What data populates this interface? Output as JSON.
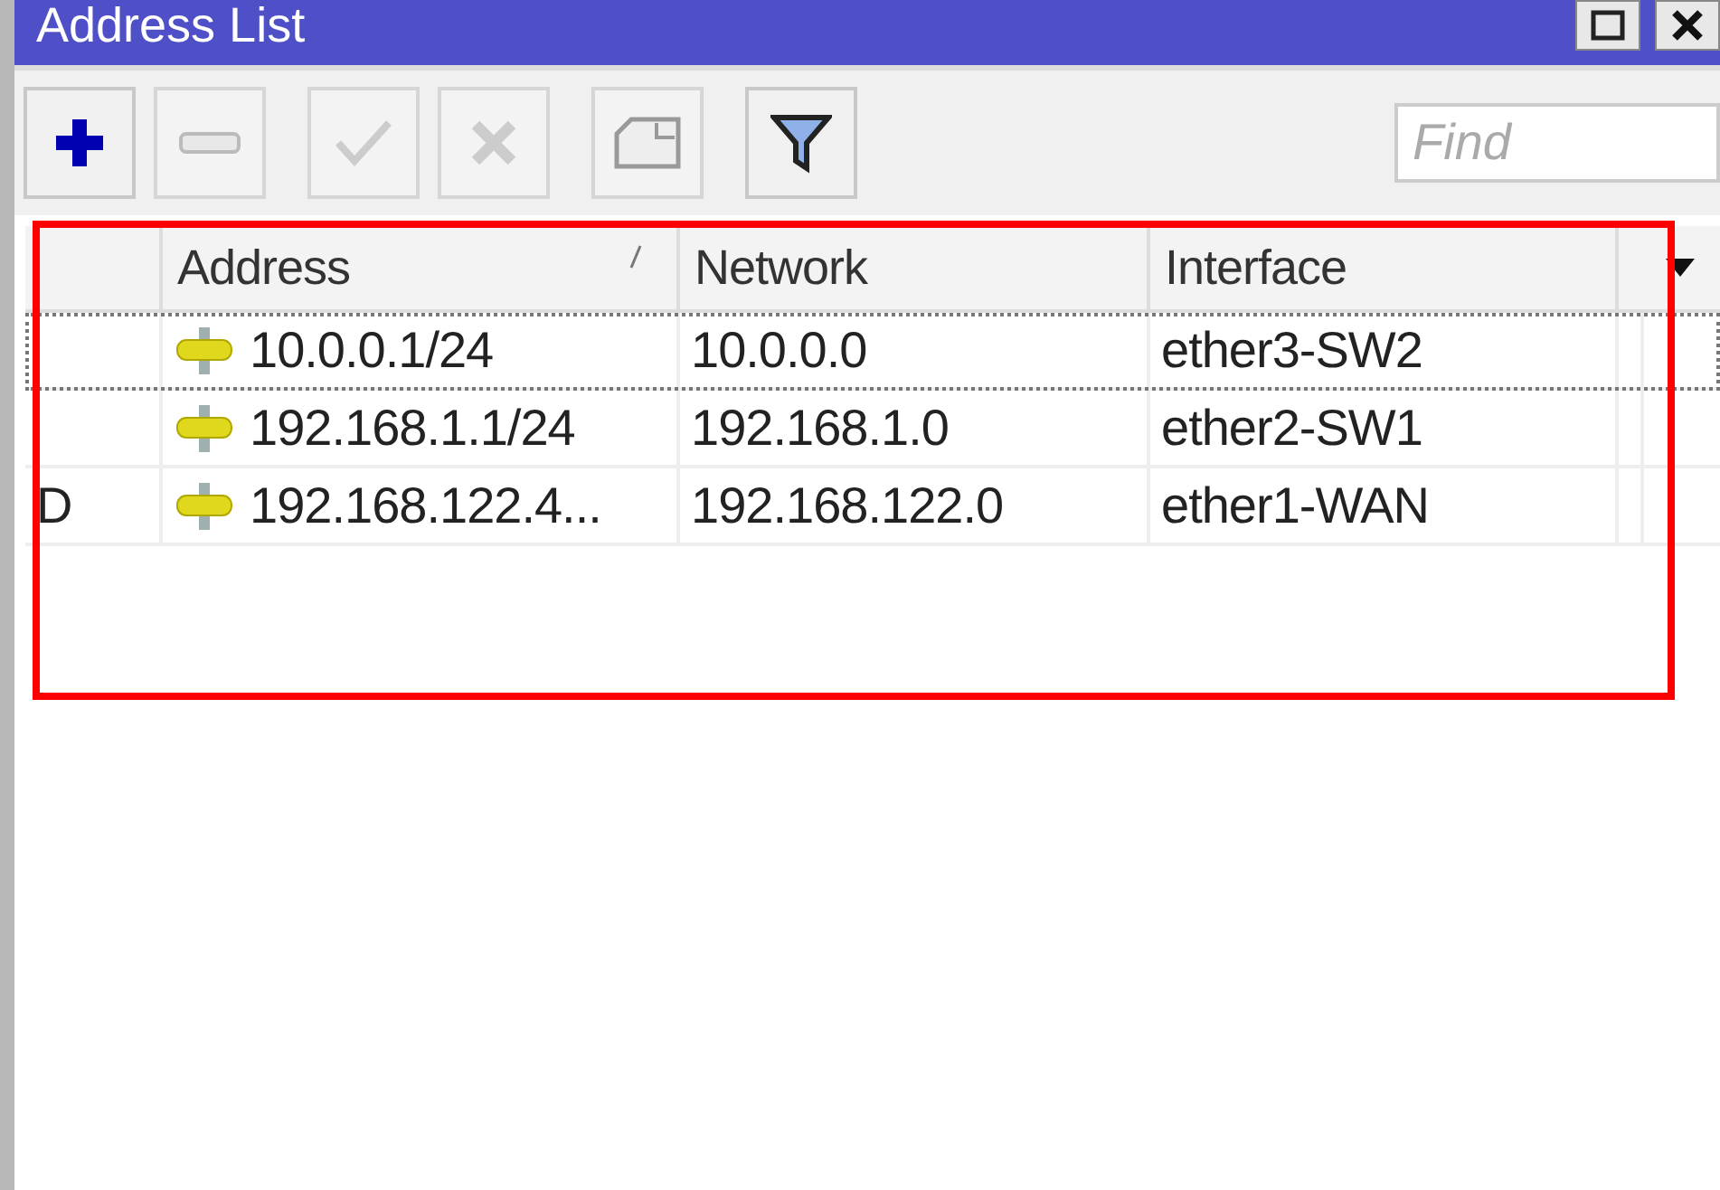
{
  "window": {
    "title": "Address List"
  },
  "toolbar": {
    "buttons": [
      {
        "kind": "add",
        "disabled": false
      },
      {
        "kind": "remove",
        "disabled": true
      },
      {
        "kind": "enable",
        "disabled": true
      },
      {
        "kind": "disable",
        "disabled": true
      },
      {
        "kind": "comment",
        "disabled": true
      },
      {
        "kind": "filter",
        "disabled": false
      }
    ],
    "find": {
      "placeholder": "Find"
    }
  },
  "table": {
    "columns": [
      {
        "label": "Address",
        "sorted": true
      },
      {
        "label": "Network",
        "sorted": false
      },
      {
        "label": "Interface",
        "sorted": false
      }
    ],
    "rows": [
      {
        "address": "10.0.0.1/24",
        "network": "10.0.0.0",
        "interface": "ether3-SW2",
        "focused": true
      },
      {
        "address": "192.168.1.1/24",
        "network": "192.168.1.0",
        "interface": "ether2-SW1",
        "focused": false
      },
      {
        "flag": "D",
        "address": "192.168.122.4...",
        "network": "192.168.122.0",
        "interface": "ether1-WAN",
        "focused": false
      }
    ]
  },
  "highlight_box": {
    "kind": "rectangle"
  }
}
